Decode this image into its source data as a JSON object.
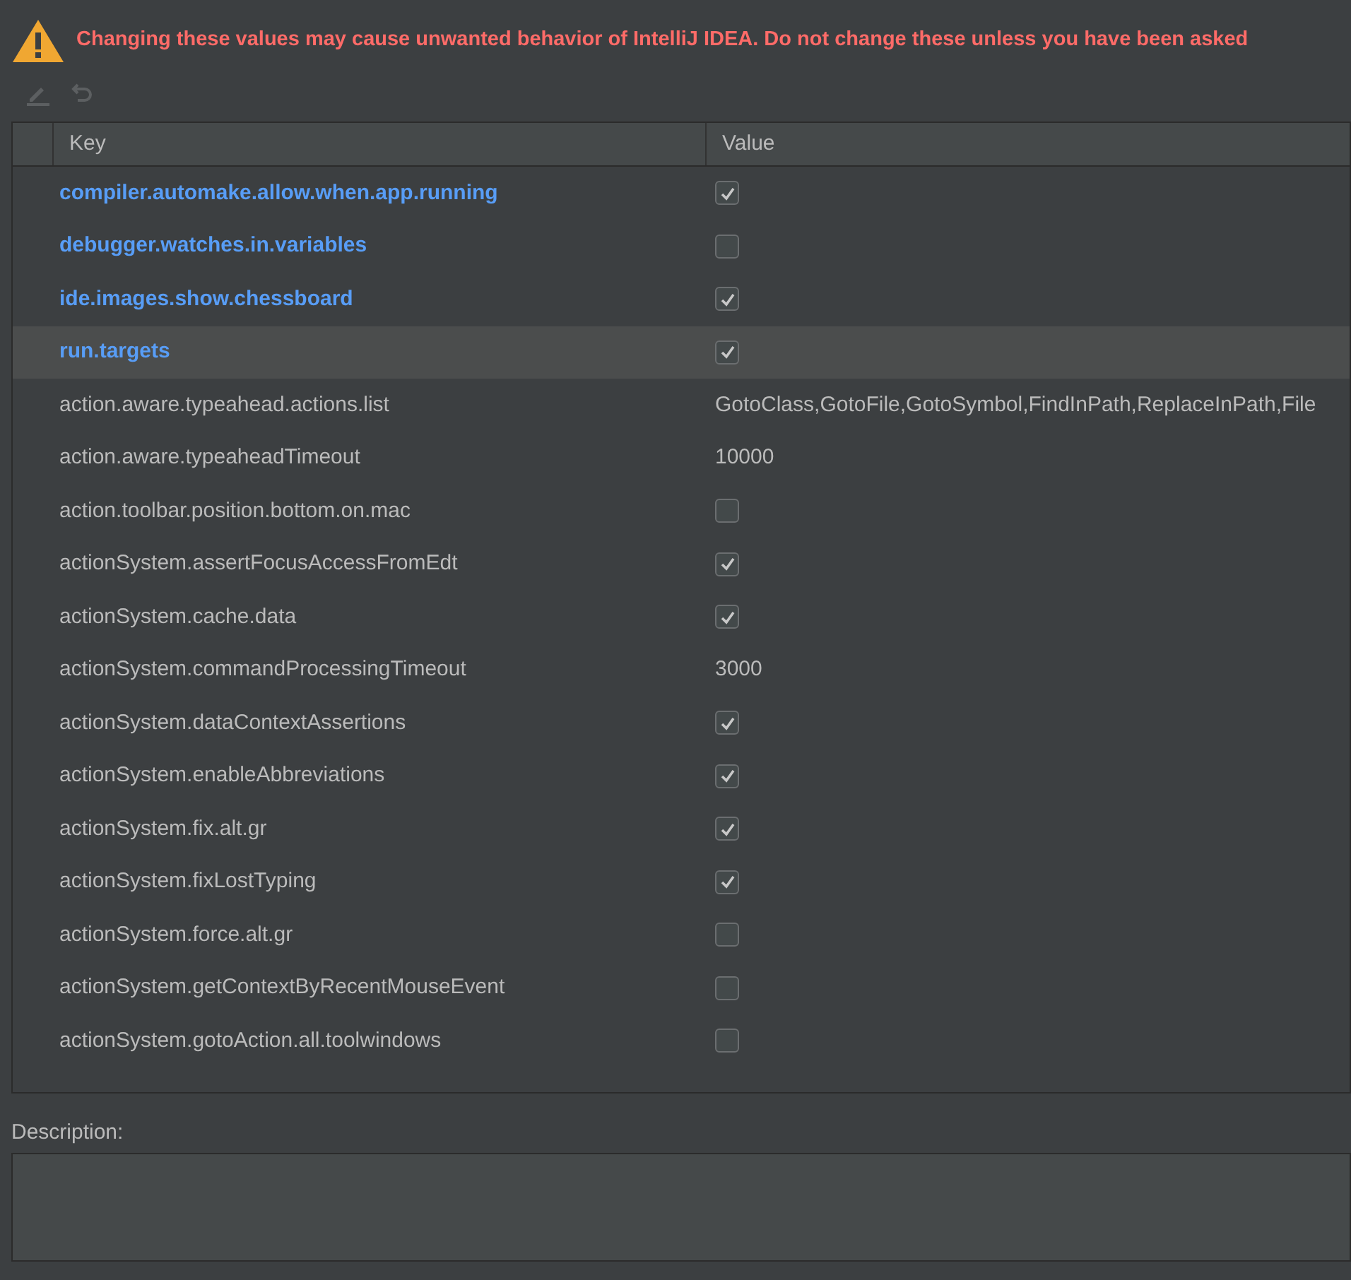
{
  "warning": "Changing these values may cause unwanted behavior of IntelliJ IDEA. Do not change these unless you have been asked",
  "toolbar": [
    {
      "kind": "edit",
      "disabled": true
    },
    {
      "kind": "undo",
      "disabled": true
    }
  ],
  "table": {
    "columns": [
      "Key",
      "Value"
    ],
    "rows": [
      {
        "key": "compiler.automake.allow.when.app.running",
        "modified": true,
        "selected": false,
        "kind": "checkbox",
        "checked": true
      },
      {
        "key": "debugger.watches.in.variables",
        "modified": true,
        "selected": false,
        "kind": "checkbox",
        "checked": false
      },
      {
        "key": "ide.images.show.chessboard",
        "modified": true,
        "selected": false,
        "kind": "checkbox",
        "checked": true
      },
      {
        "key": "run.targets",
        "modified": true,
        "selected": true,
        "kind": "checkbox",
        "checked": true
      },
      {
        "key": "action.aware.typeahead.actions.list",
        "modified": false,
        "selected": false,
        "kind": "text",
        "value": "GotoClass,GotoFile,GotoSymbol,FindInPath,ReplaceInPath,File"
      },
      {
        "key": "action.aware.typeaheadTimeout",
        "modified": false,
        "selected": false,
        "kind": "text",
        "value": "10000"
      },
      {
        "key": "action.toolbar.position.bottom.on.mac",
        "modified": false,
        "selected": false,
        "kind": "checkbox",
        "checked": false
      },
      {
        "key": "actionSystem.assertFocusAccessFromEdt",
        "modified": false,
        "selected": false,
        "kind": "checkbox",
        "checked": true
      },
      {
        "key": "actionSystem.cache.data",
        "modified": false,
        "selected": false,
        "kind": "checkbox",
        "checked": true
      },
      {
        "key": "actionSystem.commandProcessingTimeout",
        "modified": false,
        "selected": false,
        "kind": "text",
        "value": "3000"
      },
      {
        "key": "actionSystem.dataContextAssertions",
        "modified": false,
        "selected": false,
        "kind": "checkbox",
        "checked": true
      },
      {
        "key": "actionSystem.enableAbbreviations",
        "modified": false,
        "selected": false,
        "kind": "checkbox",
        "checked": true
      },
      {
        "key": "actionSystem.fix.alt.gr",
        "modified": false,
        "selected": false,
        "kind": "checkbox",
        "checked": true
      },
      {
        "key": "actionSystem.fixLostTyping",
        "modified": false,
        "selected": false,
        "kind": "checkbox",
        "checked": true
      },
      {
        "key": "actionSystem.force.alt.gr",
        "modified": false,
        "selected": false,
        "kind": "checkbox",
        "checked": false
      },
      {
        "key": "actionSystem.getContextByRecentMouseEvent",
        "modified": false,
        "selected": false,
        "kind": "checkbox",
        "checked": false
      },
      {
        "key": "actionSystem.gotoAction.all.toolwindows",
        "modified": false,
        "selected": false,
        "kind": "checkbox",
        "checked": false
      }
    ]
  },
  "description": {
    "label": "Description:"
  }
}
